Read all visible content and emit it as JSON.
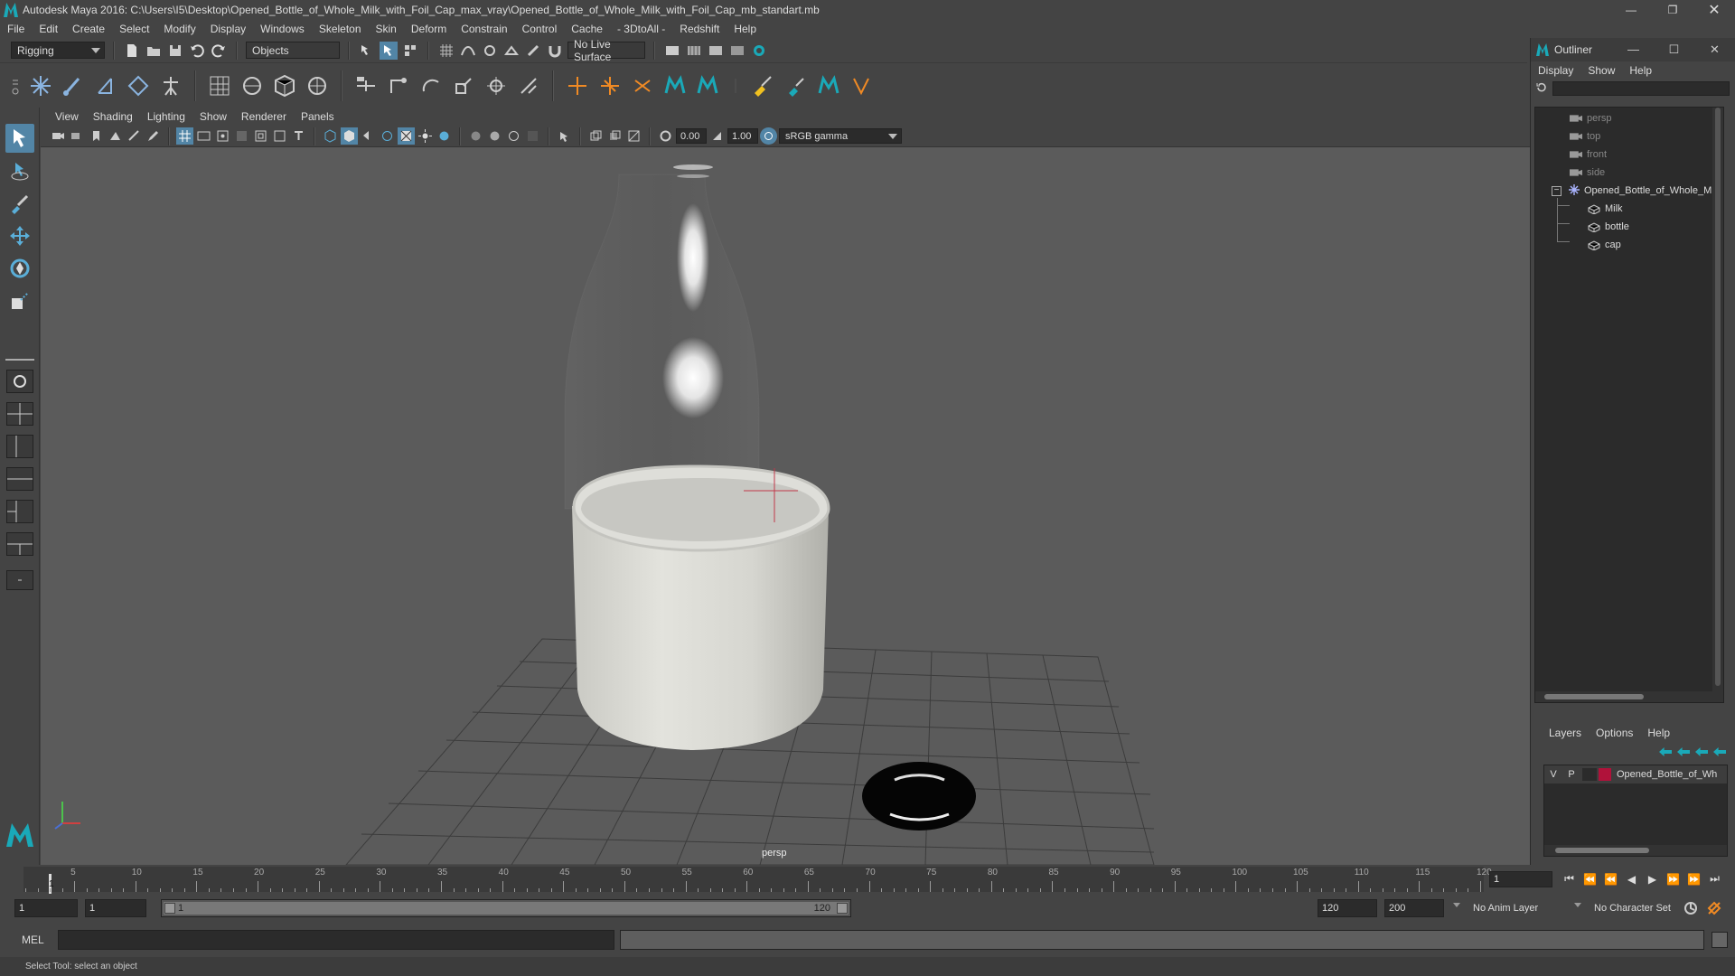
{
  "window": {
    "title": "Autodesk Maya 2016: C:\\Users\\I5\\Desktop\\Opened_Bottle_of_Whole_Milk_with_Foil_Cap_max_vray\\Opened_Bottle_of_Whole_Milk_with_Foil_Cap_mb_standart.mb",
    "minimize": "—",
    "maximize": "❐",
    "close": "✕"
  },
  "menubar": [
    "File",
    "Edit",
    "Create",
    "Select",
    "Modify",
    "Display",
    "Windows",
    "Skeleton",
    "Skin",
    "Deform",
    "Constrain",
    "Control",
    "Cache",
    "- 3DtoAll -",
    "Redshift",
    "Help"
  ],
  "statusline": {
    "mode": "Rigging",
    "selection_mode": "Objects",
    "live_surface": "No Live Surface"
  },
  "viewport": {
    "menu": [
      "View",
      "Shading",
      "Lighting",
      "Show",
      "Renderer",
      "Panels"
    ],
    "exposure": "0.00",
    "gamma": "1.00",
    "color_space": "sRGB gamma",
    "camera_label": "persp"
  },
  "outliner": {
    "title": "Outliner",
    "menu": [
      "Display",
      "Show",
      "Help"
    ],
    "items": [
      {
        "label": "persp",
        "type": "camera",
        "dim": true
      },
      {
        "label": "top",
        "type": "camera",
        "dim": true
      },
      {
        "label": "front",
        "type": "camera",
        "dim": true
      },
      {
        "label": "side",
        "type": "camera",
        "dim": true
      },
      {
        "label": "Opened_Bottle_of_Whole_M",
        "type": "group",
        "dim": false
      },
      {
        "label": "Milk",
        "type": "mesh",
        "dim": false
      },
      {
        "label": "bottle",
        "type": "mesh",
        "dim": false
      },
      {
        "label": "cap",
        "type": "mesh",
        "dim": false
      }
    ]
  },
  "layers": {
    "menu": [
      "Layers",
      "Options",
      "Help"
    ],
    "rows": [
      {
        "v": "V",
        "p": "P",
        "name": "Opened_Bottle_of_Wh",
        "color": "#b0123a"
      }
    ]
  },
  "timeline": {
    "ticks": [
      5,
      10,
      15,
      20,
      25,
      30,
      35,
      40,
      45,
      50,
      55,
      60,
      65,
      70,
      75,
      80,
      85,
      90,
      95,
      100,
      105,
      110,
      115,
      120
    ],
    "start": 1,
    "end": 120,
    "current_frame": "1",
    "current_label": "1"
  },
  "range": {
    "start_time": "1",
    "playback_start": "1",
    "slider_start": "1",
    "slider_end": "120",
    "playback_end": "120",
    "end_time": "200",
    "anim_layer": "No Anim Layer",
    "character_set": "No Character Set"
  },
  "command": {
    "language": "MEL"
  },
  "help_line": "Select Tool: select an object"
}
